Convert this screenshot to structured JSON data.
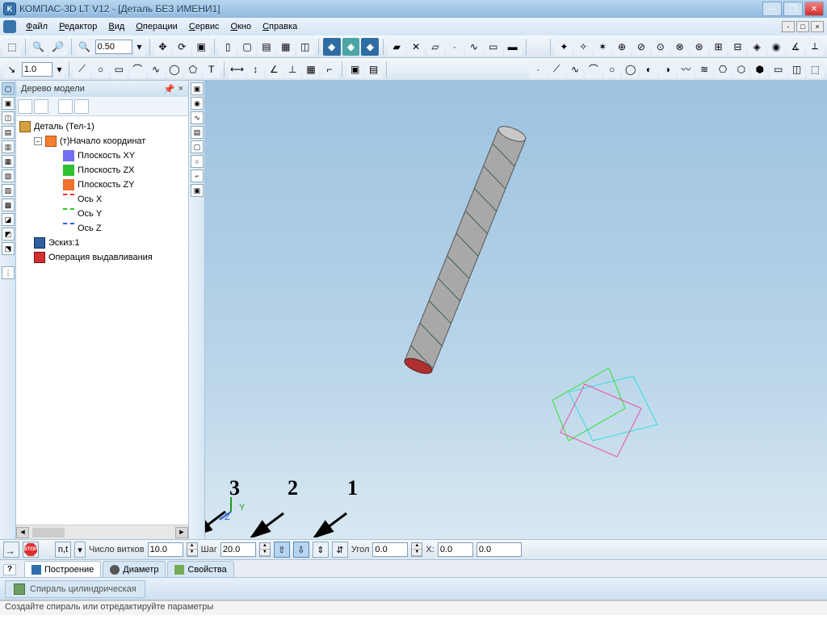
{
  "window": {
    "title": "КОМПАС-3D LT V12 - [Деталь БЕЗ ИМЕНИ1]"
  },
  "menu": {
    "file": "Файл",
    "edit": "Редактор",
    "view": "Вид",
    "operations": "Операции",
    "service": "Сервис",
    "window": "Окно",
    "help": "Справка"
  },
  "toolbar": {
    "zoom_value": "0.50",
    "step_value": "1.0"
  },
  "panel": {
    "title": "Дерево модели"
  },
  "tree": {
    "root": "Деталь (Тел-1)",
    "origin": "(т)Начало координат",
    "plane_xy": "Плоскость XY",
    "plane_zx": "Плоскость ZX",
    "plane_zy": "Плоскость ZY",
    "axis_x": "Ось X",
    "axis_y": "Ось Y",
    "axis_z": "Ось Z",
    "sketch": "Эскиз:1",
    "extrude": "Операция выдавливания"
  },
  "annotations": {
    "a1": "1",
    "a2": "2",
    "a3": "3"
  },
  "viewport_labels": {
    "y": "Y",
    "z": "Z"
  },
  "propbar": {
    "nt_btn": "n,t",
    "turns_label": "Число витков",
    "turns_value": "10.0",
    "step_label": "Шаг",
    "step_value": "20.0",
    "angle_label": "Угол",
    "angle_value": "0.0",
    "x_label": "X:",
    "x_value": "0.0",
    "y_value": "0.0"
  },
  "tabs": {
    "build": "Построение",
    "diameter": "Диаметр",
    "props": "Свойства"
  },
  "doctab": {
    "label": "Спираль цилиндрическая"
  },
  "status": {
    "text": "Создайте спираль или отредактируйте параметры"
  }
}
